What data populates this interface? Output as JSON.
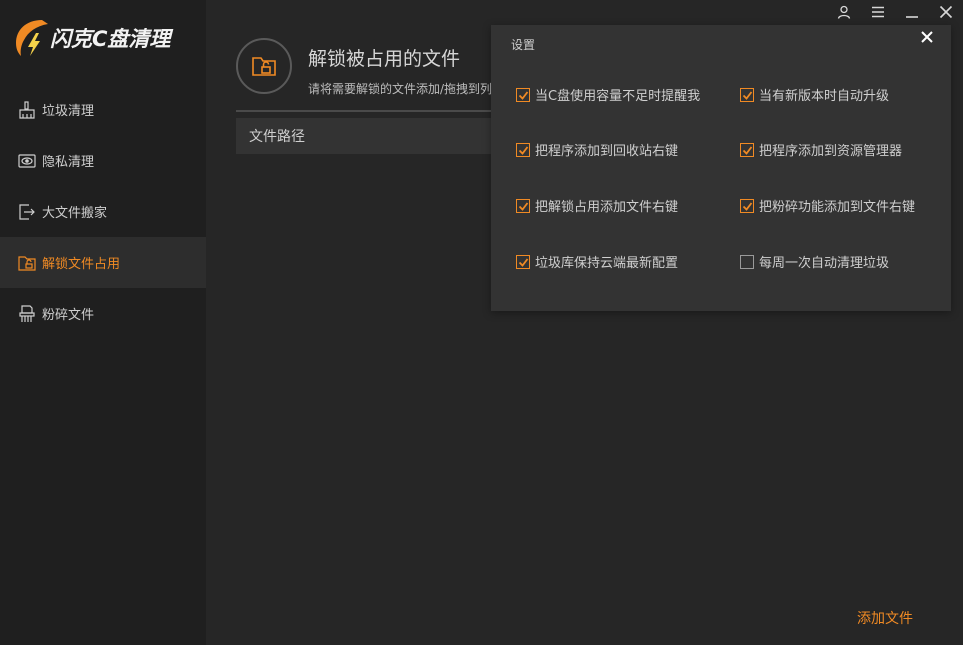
{
  "app": {
    "logo_text": "闪克C盘清理",
    "accent_color": "#f08a24"
  },
  "window_controls": [
    {
      "name": "user-icon"
    },
    {
      "name": "menu-icon"
    },
    {
      "name": "minimize-icon"
    },
    {
      "name": "close-icon"
    }
  ],
  "sidebar": {
    "items": [
      {
        "label": "垃圾清理",
        "icon": "broom-icon",
        "active": false
      },
      {
        "label": "隐私清理",
        "icon": "privacy-icon",
        "active": false
      },
      {
        "label": "大文件搬家",
        "icon": "move-file-icon",
        "active": false
      },
      {
        "label": "解锁文件占用",
        "icon": "unlock-folder-icon",
        "active": true
      },
      {
        "label": "粉碎文件",
        "icon": "shredder-icon",
        "active": false
      }
    ]
  },
  "main": {
    "title": "解锁被占用的文件",
    "subtitle": "请将需要解锁的文件添加/拖拽到列",
    "table": {
      "column": "文件路径"
    },
    "add_file_label": "添加文件"
  },
  "settings": {
    "title": "设置",
    "options": [
      {
        "label": "当C盘使用容量不足时提醒我",
        "checked": true
      },
      {
        "label": "当有新版本时自动升级",
        "checked": true
      },
      {
        "label": "把程序添加到回收站右键",
        "checked": true
      },
      {
        "label": "把程序添加到资源管理器",
        "checked": true
      },
      {
        "label": "把解锁占用添加文件右键",
        "checked": true
      },
      {
        "label": "把粉碎功能添加到文件右键",
        "checked": true
      },
      {
        "label": "垃圾库保持云端最新配置",
        "checked": true
      },
      {
        "label": "每周一次自动清理垃圾",
        "checked": false
      }
    ]
  }
}
